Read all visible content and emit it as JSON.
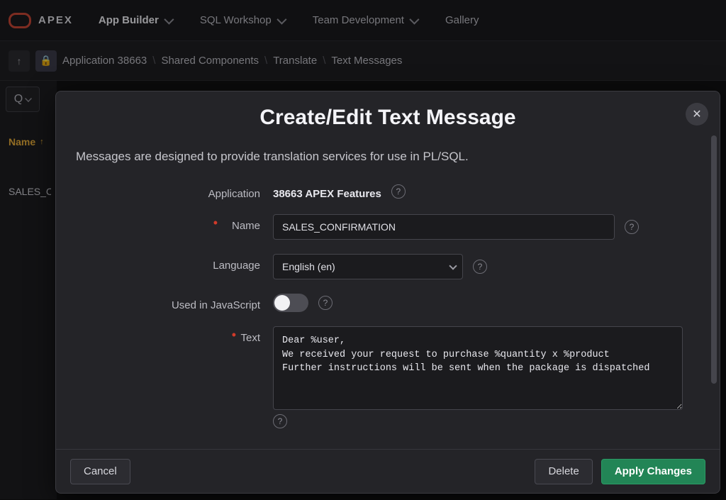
{
  "brand": "APEX",
  "nav": {
    "app_builder": "App Builder",
    "sql_workshop": "SQL Workshop",
    "team_dev": "Team Development",
    "gallery": "Gallery"
  },
  "breadcrumb": {
    "app": "Application 38663",
    "shared": "Shared Components",
    "translate": "Translate",
    "text_messages": "Text Messages"
  },
  "grid": {
    "col_name": "Name",
    "row0_name": "SALES_CON"
  },
  "modal": {
    "title": "Create/Edit Text Message",
    "desc": "Messages are designed to provide translation services for use in PL/SQL.",
    "labels": {
      "application": "Application",
      "name": "Name",
      "language": "Language",
      "used_in_js": "Used in JavaScript",
      "text": "Text"
    },
    "values": {
      "application": "38663 APEX Features",
      "name": "SALES_CONFIRMATION",
      "language": "English (en)",
      "used_in_js": false,
      "text": "Dear %user,\nWe received your request to purchase %quantity x %product\nFurther instructions will be sent when the package is dispatched"
    },
    "buttons": {
      "cancel": "Cancel",
      "delete": "Delete",
      "apply": "Apply Changes"
    }
  }
}
